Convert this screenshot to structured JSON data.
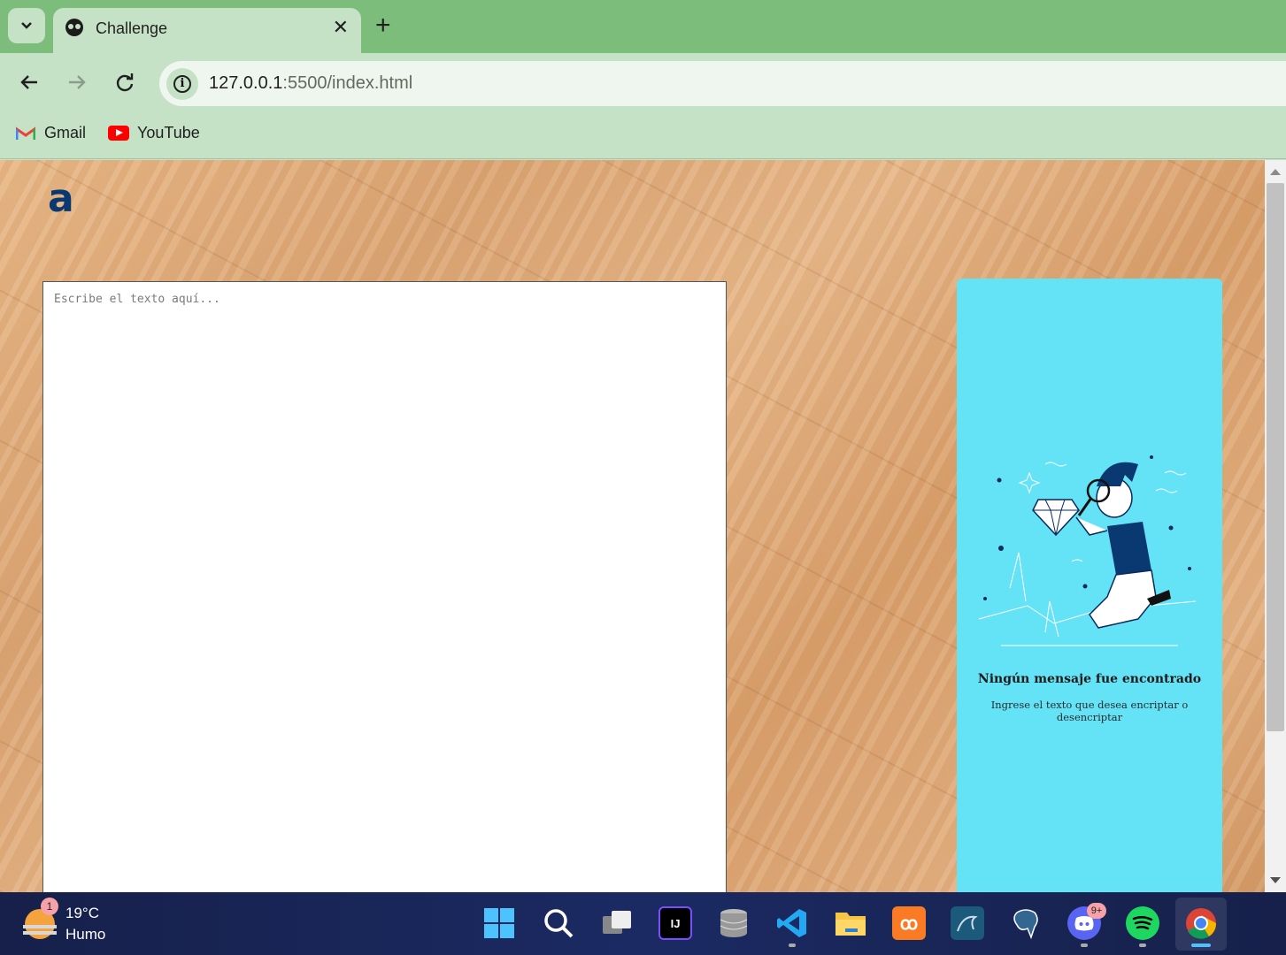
{
  "browser": {
    "tab_title": "Challenge",
    "url_host": "127.0.0.1",
    "url_rest": ":5500/index.html",
    "bookmarks": [
      {
        "label": "Gmail"
      },
      {
        "label": "YouTube"
      }
    ]
  },
  "page": {
    "logo": "a",
    "textarea_placeholder": "Escribe el texto aquí...",
    "panel_title": "Ningún mensaje fue encontrado",
    "panel_subtitle": "Ingrese el texto que desea encriptar o desencriptar"
  },
  "taskbar": {
    "temperature": "19°C",
    "condition": "Humo",
    "weather_badge": "1",
    "discord_badge": "9+",
    "apps": [
      "windows-start",
      "search",
      "task-view",
      "intellij",
      "database",
      "vscode",
      "file-explorer",
      "xampp",
      "mysql-workbench",
      "postgresql",
      "discord",
      "spotify",
      "chrome"
    ]
  },
  "colors": {
    "chrome_accent": "#7cbd7c",
    "chrome_bg": "#c6e2c6",
    "panel_bg": "#65e3f6",
    "logo_color": "#0a3871"
  }
}
